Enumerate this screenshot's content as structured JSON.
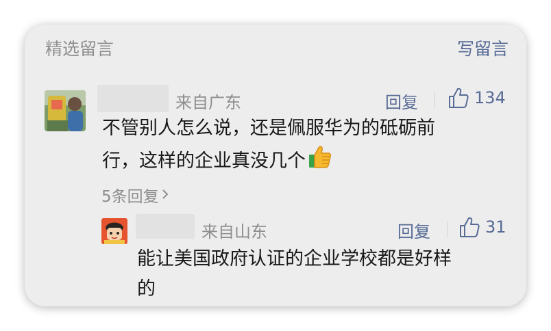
{
  "header": {
    "title": "精选留言",
    "write_label": "写留言"
  },
  "comment": {
    "location": "来自广东",
    "reply_label": "回复",
    "likes": "134",
    "text_line1": "不管别人怎么说，还是佩服华为的砥砺前",
    "text_line2": "行，这样的企业真没几个",
    "emoji": "thumbs-up",
    "more_replies": "5条回复"
  },
  "reply": {
    "location": "来自山东",
    "reply_label": "回复",
    "likes": "31",
    "text_line1": "能让美国政府认证的企业学校都是好样",
    "text_line2": "的"
  },
  "colors": {
    "link": "#576b95",
    "meta": "#8e8e8e",
    "card": "#ededed",
    "text": "#181818"
  }
}
